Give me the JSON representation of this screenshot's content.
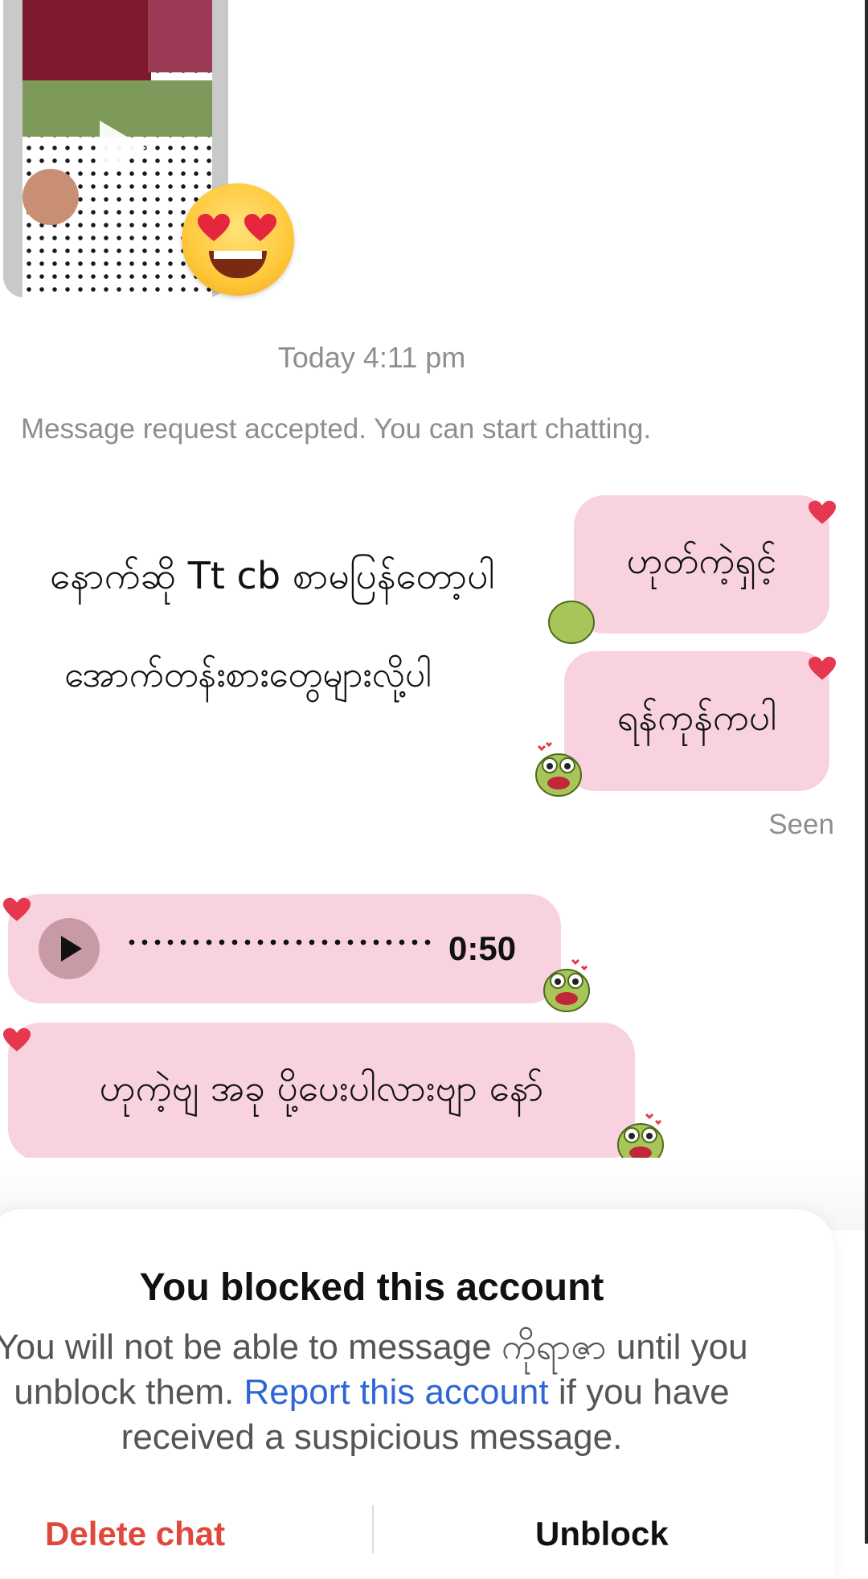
{
  "media_post": {
    "type": "video",
    "play_icon": "play-icon",
    "reaction": "heart-eyes-emoji"
  },
  "thread": {
    "timestamp": "Today 4:11 pm",
    "system_note": "Message request accepted. You can start chatting.",
    "outgoing": [
      {
        "text": "ဟုတ်ကဲ့ရှင့်",
        "reply": "နောက်ဆို Tt cb စာမပြန်တော့ပါ"
      },
      {
        "text": "ရန်ကုန်ကပါ",
        "reply": "အောက်တန်းစားတွေများလို့ပါ"
      }
    ],
    "seen_label": "Seen",
    "incoming": {
      "voice": {
        "duration": "0:50"
      },
      "text": "ဟုကဲ့ဗျ အခု ပို့ပေးပါလားဗျာ နော်"
    }
  },
  "blocked": {
    "title": "You blocked this account",
    "body_part1": "You will not be able to message ကိုရာဇာ until you unblock them.",
    "link_text": "Report this account",
    "body_part2": "if you have received a suspicious message.",
    "delete_label": "Delete chat",
    "unblock_label": "Unblock"
  },
  "colors": {
    "bubble": "#f8d3df",
    "accent_link": "#2e66d4",
    "danger": "#e0483b",
    "muted": "#8e8e8e",
    "heart": "#e5384e"
  }
}
